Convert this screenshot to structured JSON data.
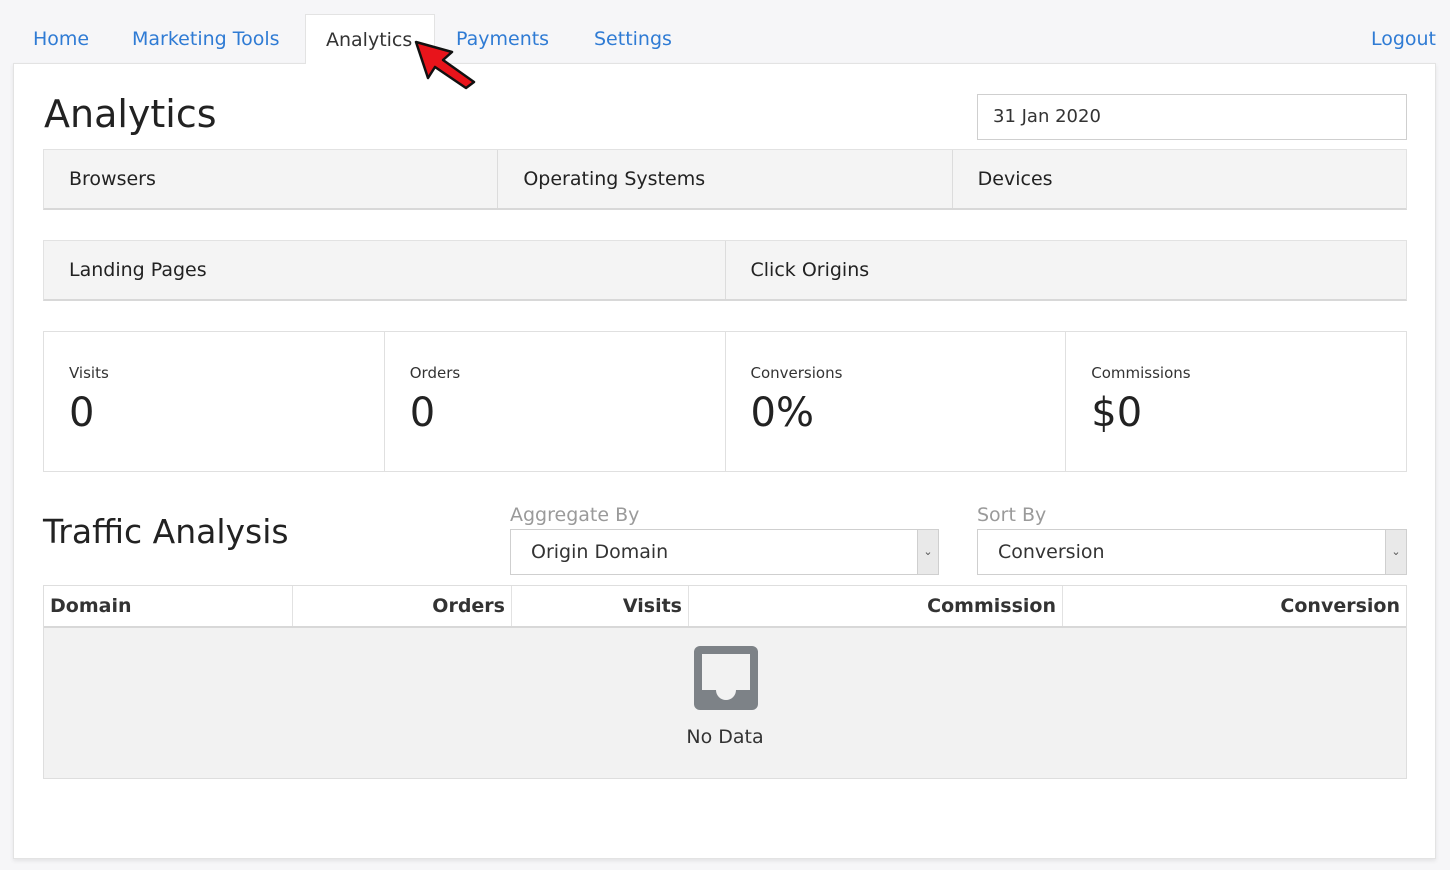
{
  "nav": {
    "tabs": [
      {
        "label": "Home"
      },
      {
        "label": "Marketing Tools"
      },
      {
        "label": "Analytics"
      },
      {
        "label": "Payments"
      },
      {
        "label": "Settings"
      }
    ],
    "active_tab": "Analytics",
    "logout_label": "Logout"
  },
  "page": {
    "title": "Analytics",
    "date_value": "31 Jan 2020"
  },
  "report_tabs_row1": [
    "Browsers",
    "Operating Systems",
    "Devices"
  ],
  "report_tabs_row2": [
    "Landing Pages",
    "Click Origins"
  ],
  "stats": [
    {
      "label": "Visits",
      "value": "0"
    },
    {
      "label": "Orders",
      "value": "0"
    },
    {
      "label": "Conversions",
      "value": "0%"
    },
    {
      "label": "Commissions",
      "value": "$0"
    }
  ],
  "traffic": {
    "title": "Traffic Analysis",
    "aggregate_label": "Aggregate By",
    "aggregate_value": "Origin Domain",
    "sort_label": "Sort By",
    "sort_value": "Conversion",
    "columns": [
      "Domain",
      "Orders",
      "Visits",
      "Commission",
      "Conversion"
    ],
    "empty_text": "No Data"
  },
  "colors": {
    "link": "#2f7bd4",
    "arrow": "#e8141b"
  },
  "icons": {
    "arrow": "red-pointer-arrow-icon",
    "empty": "inbox-icon",
    "caret": "chevron-down-icon"
  }
}
